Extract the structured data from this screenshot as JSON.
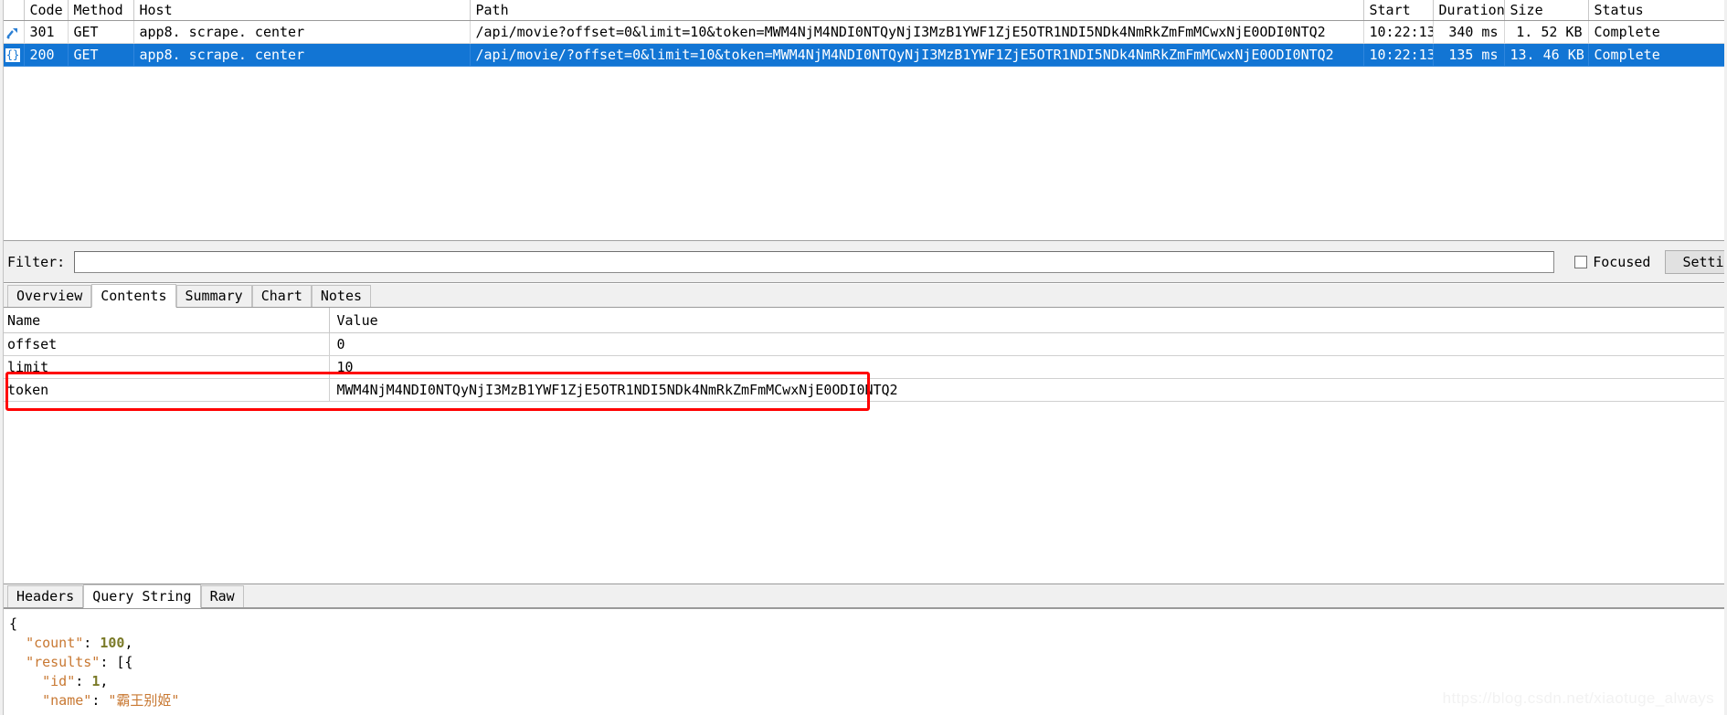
{
  "request_list": {
    "columns": [
      "",
      "Code",
      "Method",
      "Host",
      "Path",
      "Start",
      "Duration",
      "Size",
      "Status"
    ],
    "rows": [
      {
        "icon": "redirect-arrow-icon",
        "code": "301",
        "method": "GET",
        "host": "app8. scrape. center",
        "path": "/api/movie?offset=0&limit=10&token=MWM4NjM4NDI0NTQyNjI3MzB1YWF1ZjE5OTR1NDI5NDk4NmRkZmFmMCwxNjE0ODI0NTQ2",
        "start": "10:22:13",
        "duration": "340 ms",
        "size": "1. 52 KB",
        "status": "Complete",
        "selected": false
      },
      {
        "icon": "json-braces-icon",
        "code": "200",
        "method": "GET",
        "host": "app8. scrape. center",
        "path": "/api/movie/?offset=0&limit=10&token=MWM4NjM4NDI0NTQyNjI3MzB1YWF1ZjE5OTR1NDI5NDk4NmRkZmFmMCwxNjE0ODI0NTQ2",
        "start": "10:22:13",
        "duration": "135 ms",
        "size": "13. 46 KB",
        "status": "Complete",
        "selected": true
      }
    ]
  },
  "filter_bar": {
    "label": "Filter:",
    "value": "",
    "placeholder": "",
    "focused_label": "Focused",
    "focused_checked": false,
    "settings_label": "Settings"
  },
  "upper_tabs": [
    {
      "label": "Overview",
      "active": false
    },
    {
      "label": "Contents",
      "active": true
    },
    {
      "label": "Summary",
      "active": false
    },
    {
      "label": "Chart",
      "active": false
    },
    {
      "label": "Notes",
      "active": false
    }
  ],
  "contents_grid": {
    "columns": [
      "Name",
      "Value"
    ],
    "rows": [
      {
        "name": "offset",
        "value": "0"
      },
      {
        "name": "limit",
        "value": "10"
      },
      {
        "name": "token",
        "value": "MWM4NjM4NDI0NTQyNjI3MzB1YWF1ZjE5OTR1NDI5NDk4NmRkZmFmMCwxNjE0ODI0NTQ2"
      }
    ],
    "highlight_color": "#ff0000"
  },
  "lower_tabs": [
    {
      "label": "Headers",
      "active": false
    },
    {
      "label": "Query String",
      "active": true
    },
    {
      "label": "Raw",
      "active": false
    }
  ],
  "body_viewer": {
    "lines": [
      {
        "indent": 0,
        "parts": [
          {
            "t": "{",
            "c": "punc"
          }
        ]
      },
      {
        "indent": 1,
        "parts": [
          {
            "t": "\"count\"",
            "c": "key"
          },
          {
            "t": ": ",
            "c": "punc"
          },
          {
            "t": "100",
            "c": "num"
          },
          {
            "t": ",",
            "c": "punc"
          }
        ]
      },
      {
        "indent": 1,
        "parts": [
          {
            "t": "\"results\"",
            "c": "key"
          },
          {
            "t": ": [{",
            "c": "punc"
          }
        ]
      },
      {
        "indent": 2,
        "parts": [
          {
            "t": "\"id\"",
            "c": "key"
          },
          {
            "t": ": ",
            "c": "punc"
          },
          {
            "t": "1",
            "c": "num"
          },
          {
            "t": ",",
            "c": "punc"
          }
        ]
      },
      {
        "indent": 2,
        "parts": [
          {
            "t": "\"name\"",
            "c": "key"
          },
          {
            "t": ": ",
            "c": "punc"
          },
          {
            "t": "\"霸王别姬\"",
            "c": "str"
          }
        ]
      }
    ]
  },
  "watermark": "https://blog.csdn.net/xiaotuge_always",
  "colors": {
    "selection": "#1275d4",
    "highlight": "#ff0000",
    "chrome": "#f0f0f0"
  }
}
